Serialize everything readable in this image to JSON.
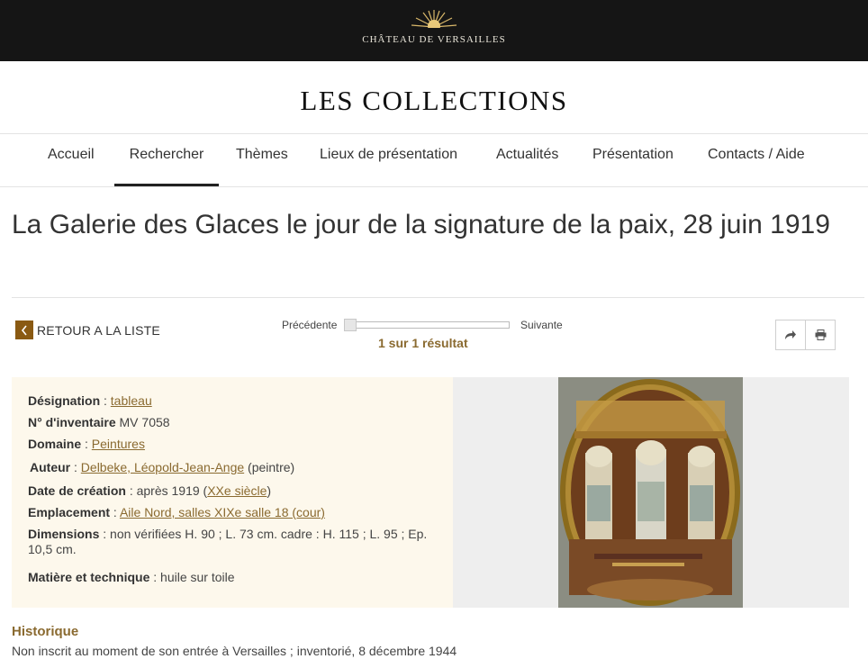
{
  "header": {
    "logo_text": "CHÂTEAU DE VERSAILLES",
    "site_title": "LES COLLECTIONS"
  },
  "nav": {
    "items": [
      {
        "label": "Accueil"
      },
      {
        "label": "Rechercher",
        "active": true
      },
      {
        "label": "Thèmes"
      },
      {
        "label": "Lieux de présentation"
      },
      {
        "label": "Actualités"
      },
      {
        "label": "Présentation"
      },
      {
        "label": "Contacts / Aide"
      }
    ]
  },
  "page": {
    "title": "La Galerie des Glaces le jour de la signature de la paix, 28 juin 1919"
  },
  "toolbar": {
    "back_label": "RETOUR A LA LISTE",
    "prev_label": "Précédente",
    "next_label": "Suivante",
    "result_count": "1 sur 1 résultat",
    "share_icon": "share-icon",
    "print_icon": "print-icon"
  },
  "details": {
    "designation_key": "Désignation",
    "designation_value": "tableau",
    "inventory_key": "N° d'inventaire",
    "inventory_value": "MV 7058",
    "domain_key": "Domaine",
    "domain_value": "Peintures",
    "author_key": "Auteur",
    "author_value": "Delbeke, Léopold-Jean-Ange",
    "author_role": "(peintre)",
    "date_key": "Date de création",
    "date_value": "après 1919 (",
    "date_link": "XXe siècle",
    "date_close": ")",
    "location_key": "Emplacement",
    "location_value": "Aile Nord, salles XIXe salle 18 (cour)",
    "dimensions_key": "Dimensions",
    "dimensions_value": "non vérifiées H. 90 ; L. 73 cm. cadre : H. 115 ; L. 95 ; Ep. 10,5 cm.",
    "technique_key": "Matière et technique",
    "technique_value": "huile sur toile"
  },
  "history": {
    "title": "Historique",
    "text": "Non inscrit au moment de son entrée à Versailles ; inventorié, 8 décembre 1944"
  },
  "colors": {
    "accent": "#8a6a30",
    "brand_dark": "#151515",
    "info_bg": "#fdf8ec",
    "back_btn": "#8a5a12"
  }
}
